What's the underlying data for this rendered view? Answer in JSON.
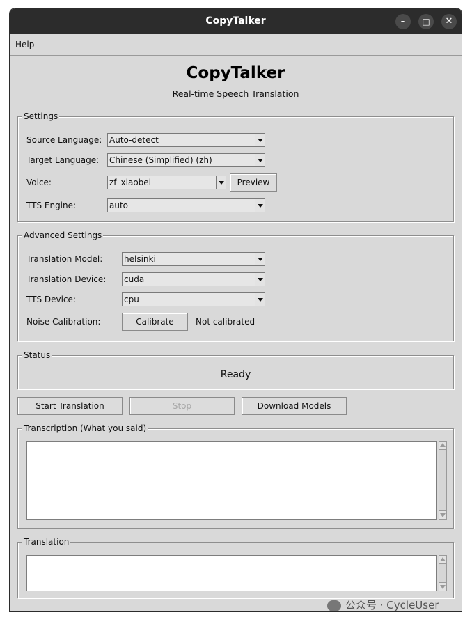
{
  "window": {
    "title": "CopyTalker"
  },
  "window_controls": {
    "minimize": "–",
    "maximize": "□",
    "close": "✕"
  },
  "menubar": {
    "items": [
      "Help"
    ]
  },
  "header": {
    "title": "CopyTalker",
    "subtitle": "Real-time Speech Translation"
  },
  "settings": {
    "legend": "Settings",
    "source_language_label": "Source Language:",
    "source_language_value": "Auto-detect",
    "target_language_label": "Target Language:",
    "target_language_value": "Chinese (Simplified) (zh)",
    "voice_label": "Voice:",
    "voice_value": "zf_xiaobei",
    "preview_button": "Preview",
    "tts_engine_label": "TTS Engine:",
    "tts_engine_value": "auto"
  },
  "advanced": {
    "legend": "Advanced Settings",
    "translation_model_label": "Translation Model:",
    "translation_model_value": "helsinki",
    "translation_device_label": "Translation Device:",
    "translation_device_value": "cuda",
    "tts_device_label": "TTS Device:",
    "tts_device_value": "cpu",
    "noise_calibration_label": "Noise Calibration:",
    "calibrate_button": "Calibrate",
    "calibration_status": "Not calibrated"
  },
  "status": {
    "legend": "Status",
    "text": "Ready"
  },
  "actions": {
    "start": "Start Translation",
    "stop": "Stop",
    "download": "Download Models"
  },
  "transcription": {
    "legend": "Transcription (What you said)",
    "text": ""
  },
  "translation": {
    "legend": "Translation",
    "text": ""
  },
  "watermark": {
    "text": "公众号 · CycleUser"
  }
}
